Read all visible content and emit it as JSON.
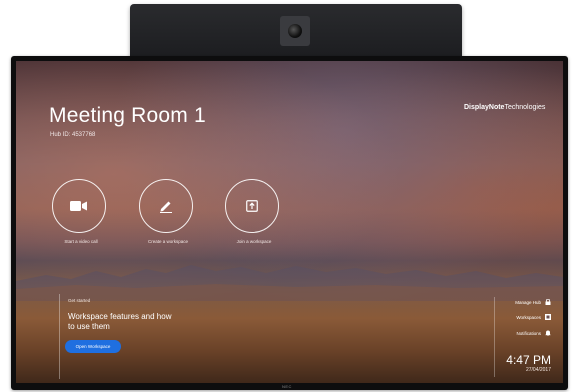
{
  "room": {
    "title": "Meeting Room 1",
    "hub_id": "Hub ID: 4537768"
  },
  "brand": {
    "name_bold": "DisplayNote",
    "name_light": "Technologies"
  },
  "actions": [
    {
      "label": "Start a video call",
      "icon": "video-camera-icon"
    },
    {
      "label": "Create a workspace",
      "icon": "pencil-icon"
    },
    {
      "label": "Join a workspace",
      "icon": "share-arrow-icon"
    }
  ],
  "help": {
    "heading": "Get started",
    "title": "Workspace features and how to use them",
    "button_label": "Open Workspace",
    "button_color": "#1f6fe0"
  },
  "side_menu": [
    {
      "label": "Manage Hub",
      "icon": "lock-icon"
    },
    {
      "label": "Workspaces",
      "icon": "workspace-icon"
    },
    {
      "label": "Notifications",
      "icon": "bell-icon"
    }
  ],
  "status": {
    "time": "4:47 PM",
    "date": "27/04/2017"
  },
  "device": {
    "monitor_brand": "NEC"
  }
}
